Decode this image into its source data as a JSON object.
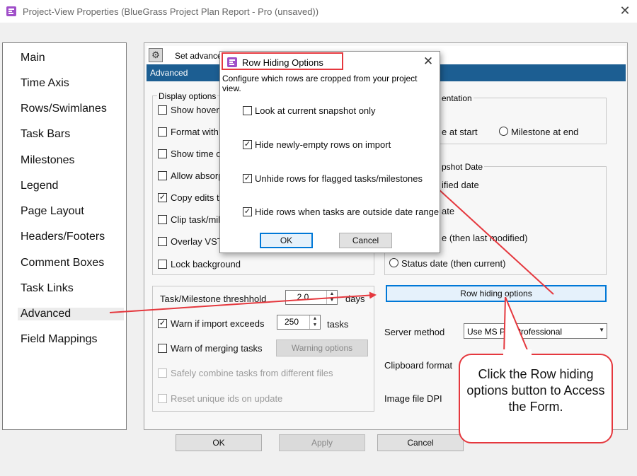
{
  "window": {
    "title": "Project-View Properties (BlueGrass Project Plan Report - Pro (unsaved))",
    "close_glyph": "✕"
  },
  "nav": {
    "items": [
      {
        "label": "Main"
      },
      {
        "label": "Time Axis"
      },
      {
        "label": "Rows/Swimlanes"
      },
      {
        "label": "Task Bars"
      },
      {
        "label": "Milestones"
      },
      {
        "label": "Legend"
      },
      {
        "label": "Page Layout"
      },
      {
        "label": "Headers/Footers"
      },
      {
        "label": "Comment Boxes"
      },
      {
        "label": "Task Links"
      },
      {
        "label": "Advanced",
        "selected": true
      },
      {
        "label": "Field Mappings"
      }
    ]
  },
  "panel": {
    "hint": "Set advance",
    "section_title": "Advanced",
    "display_options": {
      "legend": "Display options",
      "items": [
        {
          "label": "Show hover",
          "checked": false
        },
        {
          "label": "Format with",
          "checked": false
        },
        {
          "label": "Show time c",
          "checked": false
        },
        {
          "label": "Allow absorp",
          "checked": false
        },
        {
          "label": "Copy edits to",
          "checked": true
        },
        {
          "label": "Clip task/mil",
          "checked": false
        },
        {
          "label": "Overlay VST",
          "checked": false
        },
        {
          "label": "Lock background",
          "checked": false
        }
      ]
    },
    "orientation": {
      "legend": "entation",
      "option_start": "e at start",
      "option_end": "Milestone at end"
    },
    "snapshot": {
      "legend": "pshot Date",
      "option1": "ified date",
      "option2": "ate",
      "option3": "e (then last modified)",
      "option4": "Status date (then current)"
    },
    "import_box": {
      "threshold_label": "Task/Milestone threshhold",
      "threshold_value": "2.0",
      "threshold_unit": "days",
      "warn_import_label": "Warn if import exceeds",
      "warn_import_checked": true,
      "warn_import_value": "250",
      "warn_import_unit": "tasks",
      "warn_merge_label": "Warn of merging tasks",
      "warn_merge_checked": false,
      "warning_options_button": "Warning options",
      "safely_combine_label": "Safely combine tasks from different files",
      "reset_ids_label": "Reset unique ids on update"
    },
    "row_hiding_button": "Row hiding options",
    "server_method": {
      "label": "Server method",
      "value": "Use MS Pro     Professional"
    },
    "clipboard_format_label": "Clipboard format",
    "image_dpi_label": "Image file DPI"
  },
  "footer": {
    "ok": "OK",
    "apply": "Apply",
    "cancel": "Cancel"
  },
  "dialog": {
    "title": "Row Hiding Options",
    "close_glyph": "✕",
    "description": "Configure which rows are cropped from your project view.",
    "options": [
      {
        "label": "Look at current snapshot only",
        "checked": false
      },
      {
        "label": "Hide newly-empty rows on import",
        "checked": true
      },
      {
        "label": "Unhide rows for flagged tasks/milestones",
        "checked": true
      },
      {
        "label": "Hide rows when tasks are outside date range",
        "checked": true
      }
    ],
    "ok": "OK",
    "cancel": "Cancel"
  },
  "callout": {
    "text": "Click the Row hiding options button to Access the Form."
  },
  "colors": {
    "accent_blue": "#1c5e92",
    "annotation_red": "#e5383e",
    "focus_blue": "#0078d7"
  }
}
